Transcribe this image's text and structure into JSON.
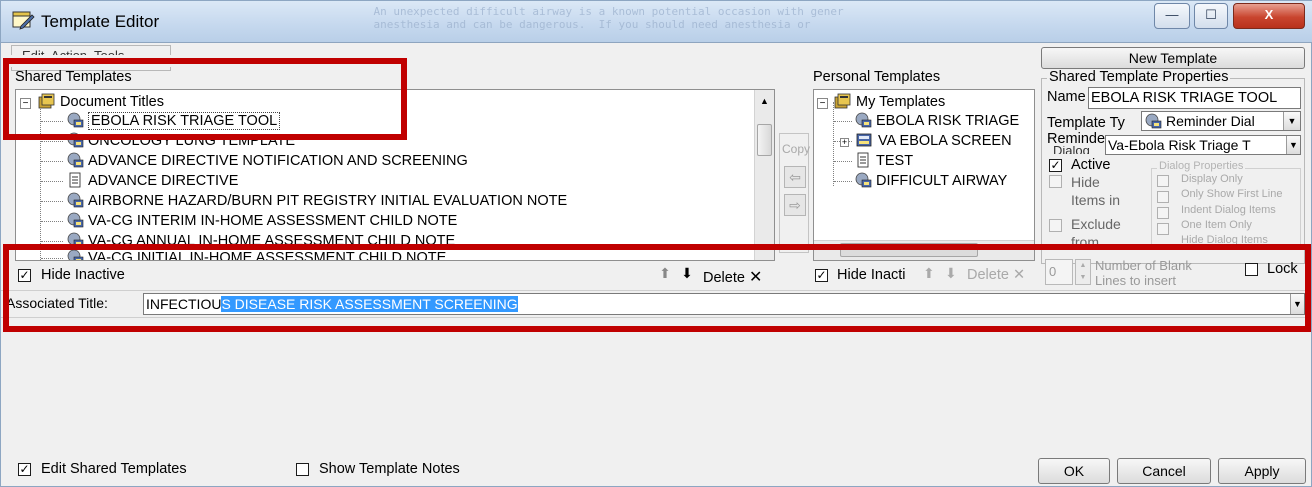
{
  "window": {
    "title": "Template Editor",
    "buttons": {
      "minimize": "—",
      "maximize": "☐",
      "close": "X"
    }
  },
  "menu": {
    "text": "Edit  Action  Tools"
  },
  "shared": {
    "heading": "Shared Templates",
    "root": "Document Titles",
    "items": [
      "EBOLA RISK TRIAGE TOOL",
      "ONCOLOGY LUNG TEMPLATE",
      "ADVANCE DIRECTIVE NOTIFICATION AND SCREENING",
      "ADVANCE DIRECTIVE",
      "AIRBORNE HAZARD/BURN PIT REGISTRY INITIAL EVALUATION NOTE",
      "VA-CG INTERIM IN-HOME ASSESSMENT CHILD NOTE",
      "VA-CG ANNUAL IN-HOME ASSESSMENT CHILD NOTE",
      "VA-CG INITIAL IN-HOME ASSESSMENT CHILD NOTE"
    ],
    "hide_inactive": "Hide Inactive",
    "delete": "Delete"
  },
  "copy": {
    "label": "Copy"
  },
  "personal": {
    "heading": "Personal Templates",
    "root": "My Templates",
    "items": [
      "EBOLA RISK TRIAGE",
      "VA EBOLA SCREEN",
      "TEST",
      "DIFFICULT AIRWAY"
    ],
    "hide_inactive": "Hide Inacti",
    "delete": "Delete"
  },
  "new_template": "New Template",
  "properties": {
    "legend": "Shared Template Properties",
    "name_label": "Name",
    "name_value": "EBOLA RISK TRIAGE TOOL",
    "type_label": "Template Ty",
    "type_value": "Reminder Dial",
    "reminder_label": "Reminde",
    "reminder_label2": "Dialog",
    "reminder_value": "Va-Ebola Risk Triage T",
    "active": "Active",
    "hide_items": "Hide Items in",
    "exclude_from": "Exclude from",
    "dialog_props": {
      "legend": "Dialog Properties",
      "options": [
        "Display Only",
        "Only Show First Line",
        "Indent Dialog Items",
        "One Item Only",
        "Hide Dialog Items"
      ]
    },
    "blank_lines_value": "0",
    "blank_lines_label": "Number of Blank Lines to insert",
    "lock": "Lock"
  },
  "associated": {
    "label": "Associated Title:",
    "value_plain": "INFECTIOU",
    "value_selected": "S DISEASE RISK ASSESSMENT SCREENING"
  },
  "footer": {
    "edit_shared": "Edit Shared Templates",
    "show_notes": "Show Template Notes",
    "ok": "OK",
    "cancel": "Cancel",
    "apply": "Apply"
  },
  "colors": {
    "selection": "#3399ff",
    "annotation": "#c00000"
  }
}
